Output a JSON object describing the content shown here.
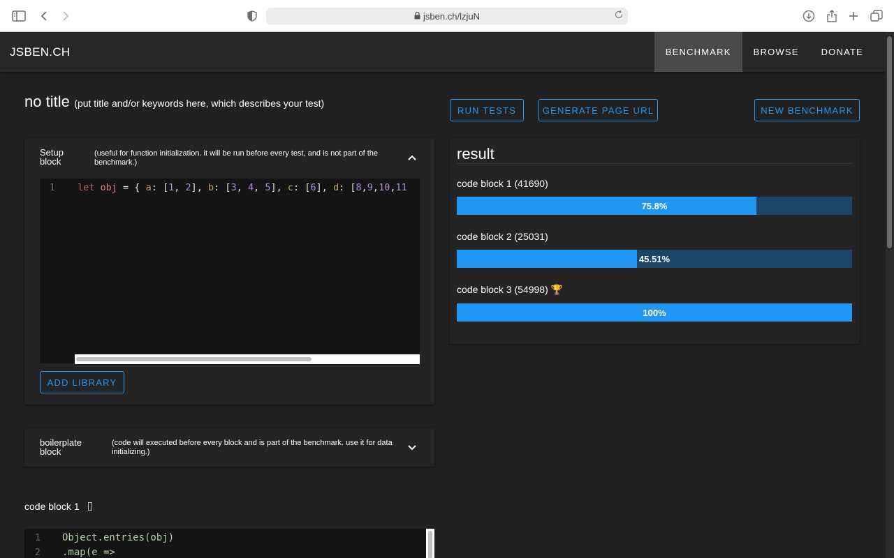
{
  "browser": {
    "url": "jsben.ch/lzjuN"
  },
  "app": {
    "brand": "JSBEN.CH",
    "nav": [
      {
        "label": "BENCHMARK",
        "active": true
      },
      {
        "label": "BROWSE",
        "active": false
      },
      {
        "label": "DONATE",
        "active": false
      }
    ]
  },
  "test": {
    "title": "no title",
    "title_hint": "(put title and/or keywords here, which describes your test)"
  },
  "setup": {
    "heading": "Setup block",
    "description": "(useful for function initialization. it will be run before every test, and is not part of the benchmark.)",
    "line_number": "1",
    "code": "let obj = { a: [1, 2], b: [3, 4, 5], c: [6], d: [8,9,10,11",
    "add_library_label": "ADD LIBRARY"
  },
  "boilerplate": {
    "heading": "boilerplate block",
    "description": "(code will executed before every block and is part of the benchmark. use it for data initializing.)"
  },
  "code_block_1": {
    "title": "code block 1",
    "lines": [
      {
        "n": "1",
        "text": "Object.entries(obj)"
      },
      {
        "n": "2",
        "text": ".map(e =>"
      }
    ]
  },
  "actions": {
    "run_tests": "RUN TESTS",
    "generate_url": "GENERATE PAGE URL",
    "new_benchmark": "NEW BENCHMARK"
  },
  "result": {
    "title": "result",
    "items": [
      {
        "label": "code block 1 (41690)",
        "percent": 75.8,
        "percent_text": "75.8%",
        "winner": false
      },
      {
        "label": "code block 2 (25031)",
        "percent": 45.51,
        "percent_text": "45.51%",
        "winner": false
      },
      {
        "label": "code block 3 (54998)",
        "percent": 100,
        "percent_text": "100%",
        "winner": true
      }
    ],
    "winner_icon": "🏆"
  },
  "colors": {
    "accent": "#2196f3",
    "bar_track": "#1b4467",
    "background": "#212121"
  }
}
